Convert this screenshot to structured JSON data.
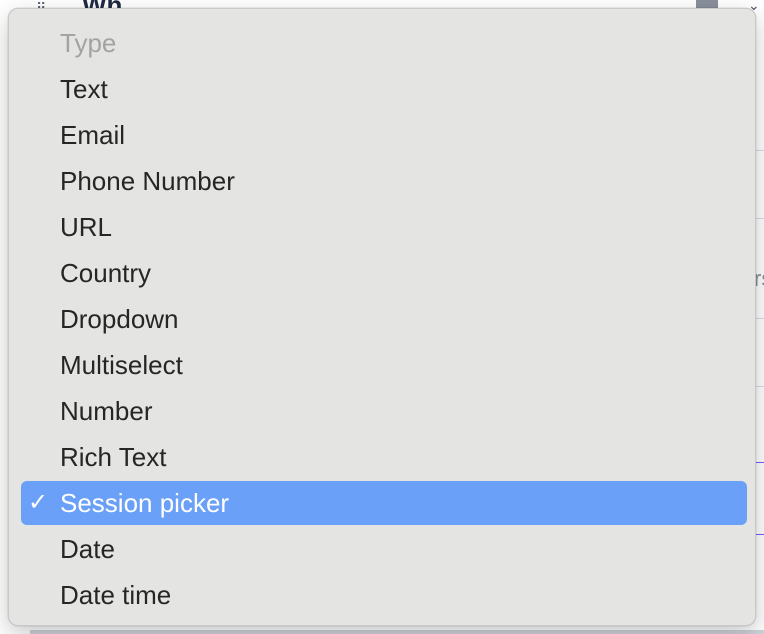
{
  "dropdown": {
    "header": "Type",
    "items": [
      {
        "label": "Text",
        "selected": false
      },
      {
        "label": "Email",
        "selected": false
      },
      {
        "label": "Phone Number",
        "selected": false
      },
      {
        "label": "URL",
        "selected": false
      },
      {
        "label": "Country",
        "selected": false
      },
      {
        "label": "Dropdown",
        "selected": false
      },
      {
        "label": "Multiselect",
        "selected": false
      },
      {
        "label": "Number",
        "selected": false
      },
      {
        "label": "Rich Text",
        "selected": false
      },
      {
        "label": "Session picker",
        "selected": true
      },
      {
        "label": "Date",
        "selected": false
      },
      {
        "label": "Date time",
        "selected": false
      }
    ],
    "checkmark_glyph": "✓",
    "selection_color": "#6aa0f7",
    "menu_background": "#e4e4e2"
  },
  "background": {
    "partial_title": "Wh",
    "partial_text_right": "rs",
    "accent_color": "#7a5cff",
    "icons": [
      "drag-handle-icon",
      "trash-icon",
      "chevron-down-icon"
    ]
  }
}
